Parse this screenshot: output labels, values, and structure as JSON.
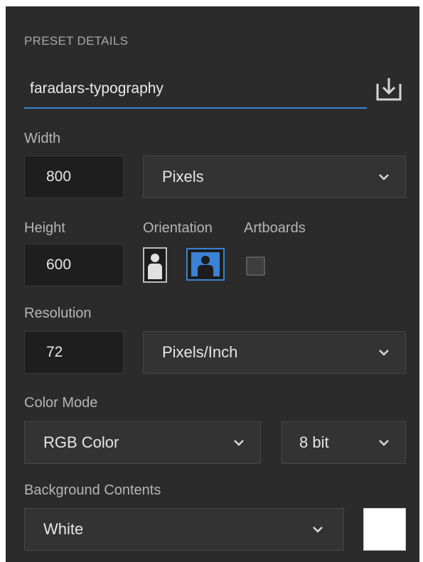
{
  "section_title": "PRESET DETAILS",
  "preset_name": "faradars-typography",
  "width": {
    "label": "Width",
    "value": "800",
    "unit": "Pixels"
  },
  "height": {
    "label": "Height",
    "value": "600"
  },
  "orientation": {
    "label": "Orientation",
    "selected": "landscape"
  },
  "artboards": {
    "label": "Artboards",
    "checked": false
  },
  "resolution": {
    "label": "Resolution",
    "value": "72",
    "unit": "Pixels/Inch"
  },
  "color_mode": {
    "label": "Color Mode",
    "mode": "RGB Color",
    "depth": "8 bit"
  },
  "background": {
    "label": "Background Contents",
    "value": "White",
    "swatch_color": "#ffffff"
  },
  "colors": {
    "accent": "#3b82d6",
    "panel": "#2b2b2b"
  }
}
